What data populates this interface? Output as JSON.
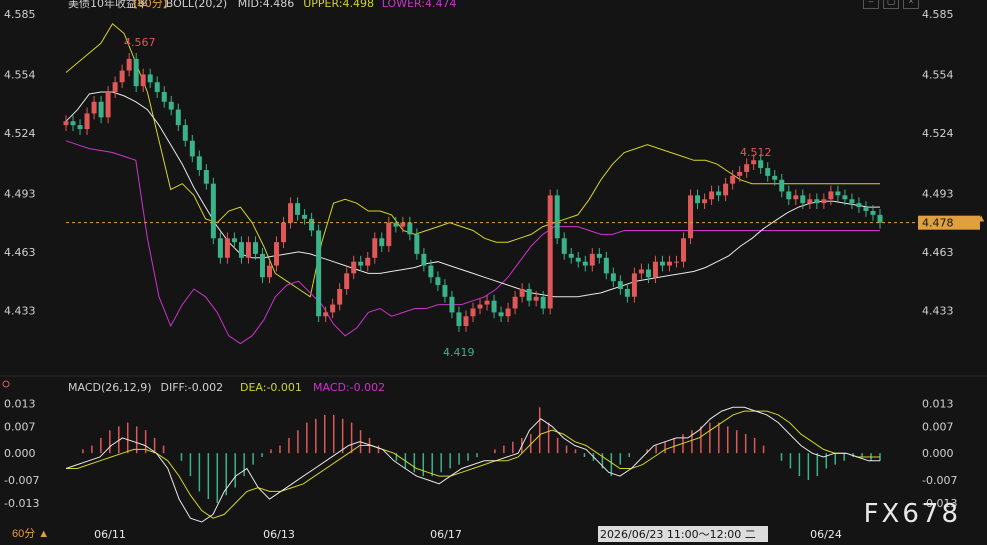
{
  "chart_data": {
    "type": "candlestick",
    "title": "美债10年收益率",
    "interval_label": "【60分】",
    "boll_label": "BOLL(20,2)",
    "mid_label": "MID:4.486",
    "upper_label": "UPPER:4.498",
    "lower_label": "LOWER:4.474",
    "macd_label": "MACD(26,12,9)",
    "diff_label": "DIFF:-0.002",
    "dea_label": "DEA:-0.001",
    "macd_value_label": "MACD:-0.002",
    "price_ticks": [
      "4.585",
      "4.554",
      "4.524",
      "4.493",
      "4.463",
      "4.433"
    ],
    "macd_ticks": [
      "0.013",
      "0.007",
      "0.000",
      "-0.007",
      "-0.013"
    ],
    "date_ticks": [
      "06/11",
      "06/13",
      "06/17",
      "06/24"
    ],
    "current_price": "4.478",
    "high_label": "4.567",
    "low_label": "4.419",
    "mid_high_label": "4.512",
    "ylim": [
      4.42,
      4.585
    ],
    "macd_ylim": [
      -0.018,
      0.016
    ],
    "colors": {
      "up": "#e05858",
      "down": "#3bb38a",
      "mid": "#e8e8e8",
      "upper": "#d4d428",
      "lower": "#cc33cc",
      "current": "#e0a040"
    },
    "candles_up_down": "mixed",
    "close": [
      4.53,
      4.528,
      4.526,
      4.534,
      4.54,
      4.532,
      4.545,
      4.55,
      4.556,
      4.562,
      4.548,
      4.554,
      4.55,
      4.545,
      4.54,
      4.536,
      4.528,
      4.52,
      4.512,
      4.505,
      4.498,
      4.47,
      4.46,
      4.47,
      4.468,
      4.46,
      4.468,
      4.462,
      4.45,
      4.456,
      4.468,
      4.478,
      4.488,
      4.482,
      4.48,
      4.474,
      4.43,
      4.432,
      4.436,
      4.444,
      4.452,
      4.458,
      4.456,
      4.46,
      4.47,
      4.466,
      4.478,
      4.476,
      4.478,
      4.472,
      4.462,
      4.456,
      4.45,
      4.446,
      4.44,
      4.432,
      4.425,
      4.43,
      4.434,
      4.436,
      4.438,
      4.432,
      4.43,
      4.434,
      4.44,
      4.444,
      4.438,
      4.44,
      4.434,
      4.492,
      4.47,
      4.462,
      4.46,
      4.458,
      4.456,
      4.462,
      4.46,
      4.452,
      4.448,
      4.444,
      4.44,
      4.452,
      4.454,
      4.45,
      4.458,
      4.456,
      4.458,
      4.458,
      4.47,
      4.492,
      4.488,
      4.49,
      4.494,
      4.492,
      4.498,
      4.502,
      4.504,
      4.508,
      4.51,
      4.506,
      4.502,
      4.5,
      4.494,
      4.49,
      4.492,
      4.488,
      4.49,
      4.488,
      4.49,
      4.494,
      4.492,
      4.49,
      4.488,
      4.486,
      4.484,
      4.482,
      4.478
    ],
    "mid": [
      4.53,
      4.536,
      4.544,
      4.545,
      4.545,
      4.543,
      4.54,
      4.536,
      4.528,
      4.518,
      4.508,
      4.496,
      4.486,
      4.476,
      4.468,
      4.462,
      4.46,
      4.46,
      4.461,
      4.462,
      4.463,
      4.462,
      4.46,
      4.458,
      4.456,
      4.454,
      4.452,
      4.452,
      4.453,
      4.454,
      4.455,
      4.457,
      4.458,
      4.456,
      4.454,
      4.452,
      4.45,
      4.448,
      4.446,
      4.444,
      4.442,
      4.441,
      4.44,
      4.44,
      4.44,
      4.441,
      4.442,
      4.444,
      4.446,
      4.448,
      4.449,
      4.45,
      4.451,
      4.452,
      4.453,
      4.455,
      4.458,
      4.461,
      4.466,
      4.47,
      4.475,
      4.479,
      4.483,
      4.486,
      4.488,
      4.489,
      4.489,
      4.488,
      4.487,
      4.486,
      4.486
    ],
    "upper": [
      4.555,
      4.56,
      4.565,
      4.57,
      4.58,
      4.575,
      4.56,
      4.545,
      4.52,
      4.495,
      4.498,
      4.492,
      4.48,
      4.478,
      4.484,
      4.486,
      4.478,
      4.466,
      4.452,
      4.448,
      4.444,
      4.44,
      4.468,
      4.488,
      4.49,
      4.488,
      4.484,
      4.484,
      4.482,
      4.474,
      4.472,
      4.474,
      4.476,
      4.478,
      4.476,
      4.474,
      4.47,
      4.468,
      4.468,
      4.47,
      4.472,
      4.476,
      4.478,
      4.48,
      4.482,
      4.49,
      4.5,
      4.508,
      4.514,
      4.516,
      4.518,
      4.516,
      4.514,
      4.512,
      4.51,
      4.51,
      4.508,
      4.504,
      4.5,
      4.498,
      4.498,
      4.498,
      4.498,
      4.498,
      4.498,
      4.498,
      4.498,
      4.498,
      4.498,
      4.498,
      4.498
    ],
    "lower": [
      4.52,
      4.518,
      4.516,
      4.515,
      4.514,
      4.512,
      4.51,
      4.47,
      4.44,
      4.425,
      4.436,
      4.444,
      4.44,
      4.432,
      4.42,
      4.416,
      4.42,
      4.428,
      4.44,
      4.446,
      4.448,
      4.442,
      4.436,
      4.426,
      4.42,
      4.424,
      4.432,
      4.434,
      4.43,
      4.432,
      4.434,
      4.434,
      4.436,
      4.436,
      4.436,
      4.438,
      4.44,
      4.444,
      4.45,
      4.458,
      4.466,
      4.472,
      4.476,
      4.476,
      4.476,
      4.474,
      4.472,
      4.472,
      4.474,
      4.474,
      4.474,
      4.474,
      4.474,
      4.474,
      4.474,
      4.474,
      4.474,
      4.474,
      4.474,
      4.474,
      4.474,
      4.474,
      4.474,
      4.474,
      4.474,
      4.474,
      4.474,
      4.474,
      4.474,
      4.474,
      4.474
    ],
    "macd_hist": [
      0.0,
      0.001,
      0.002,
      0.004,
      0.006,
      0.007,
      0.008,
      0.007,
      0.006,
      0.004,
      0.002,
      0.0,
      -0.002,
      -0.006,
      -0.01,
      -0.012,
      -0.013,
      -0.011,
      -0.009,
      -0.006,
      -0.003,
      -0.001,
      0.001,
      0.002,
      0.004,
      0.006,
      0.008,
      0.009,
      0.01,
      0.01,
      0.009,
      0.008,
      0.006,
      0.004,
      0.002,
      0.0,
      -0.002,
      -0.004,
      -0.005,
      -0.006,
      -0.006,
      -0.005,
      -0.004,
      -0.003,
      -0.002,
      -0.001,
      0.0,
      0.001,
      0.002,
      0.003,
      0.004,
      0.005,
      0.012,
      0.008,
      0.004,
      0.002,
      0.001,
      -0.001,
      -0.002,
      -0.004,
      -0.006,
      -0.003,
      -0.001,
      0.0,
      0.001,
      0.002,
      0.003,
      0.004,
      0.005,
      0.006,
      0.007,
      0.008,
      0.008,
      0.007,
      0.006,
      0.005,
      0.004,
      0.002,
      0.0,
      -0.002,
      -0.004,
      -0.006,
      -0.007,
      -0.006,
      -0.004,
      -0.003,
      -0.002,
      -0.001,
      -0.001,
      -0.002,
      -0.002
    ],
    "diff": [
      -0.004,
      -0.003,
      -0.002,
      -0.001,
      0.002,
      0.004,
      0.003,
      0.002,
      0.0,
      -0.004,
      -0.012,
      -0.017,
      -0.018,
      -0.016,
      -0.01,
      -0.006,
      -0.004,
      -0.009,
      -0.012,
      -0.01,
      -0.008,
      -0.006,
      -0.004,
      -0.002,
      0.0,
      0.002,
      0.003,
      0.002,
      0.001,
      -0.002,
      -0.004,
      -0.006,
      -0.007,
      -0.008,
      -0.006,
      -0.004,
      -0.003,
      -0.002,
      -0.002,
      -0.001,
      0.0,
      0.006,
      0.009,
      0.007,
      0.004,
      0.002,
      0.001,
      -0.002,
      -0.005,
      -0.006,
      -0.004,
      -0.001,
      0.002,
      0.003,
      0.004,
      0.004,
      0.006,
      0.009,
      0.011,
      0.012,
      0.012,
      0.011,
      0.01,
      0.008,
      0.005,
      0.002,
      0.0,
      -0.001,
      0.0,
      0.0,
      -0.001,
      -0.002,
      -0.002
    ],
    "dea": [
      -0.004,
      -0.004,
      -0.003,
      -0.002,
      -0.001,
      0.0,
      0.001,
      0.001,
      0.0,
      -0.002,
      -0.006,
      -0.011,
      -0.015,
      -0.017,
      -0.016,
      -0.013,
      -0.01,
      -0.009,
      -0.01,
      -0.01,
      -0.009,
      -0.008,
      -0.006,
      -0.004,
      -0.002,
      0.0,
      0.002,
      0.002,
      0.001,
      0.0,
      -0.002,
      -0.004,
      -0.005,
      -0.006,
      -0.006,
      -0.005,
      -0.004,
      -0.003,
      -0.002,
      -0.002,
      -0.001,
      0.002,
      0.005,
      0.006,
      0.005,
      0.003,
      0.002,
      0.0,
      -0.002,
      -0.004,
      -0.004,
      -0.003,
      -0.001,
      0.001,
      0.002,
      0.003,
      0.004,
      0.006,
      0.008,
      0.01,
      0.011,
      0.011,
      0.011,
      0.01,
      0.008,
      0.005,
      0.003,
      0.001,
      0.0,
      0.0,
      -0.001,
      -0.001,
      -0.001
    ],
    "cursor_label": "2026/06/23 11:00～12:00 二"
  },
  "ui": {
    "interval_tab": "60分 ▲",
    "watermark": "FX678"
  }
}
